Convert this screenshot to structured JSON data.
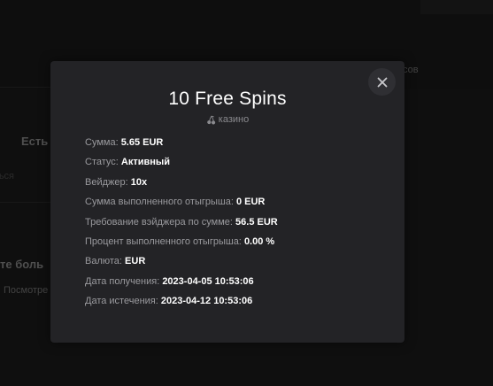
{
  "background": {
    "fragments": [
      "сов",
      "Есть",
      "Зарегистрироваться",
      "те боль",
      "Посмотре"
    ]
  },
  "modal": {
    "title": "10 Free Spins",
    "category_icon": "cherry-icon",
    "category": "казино",
    "close_icon": "close-icon",
    "details": [
      {
        "label": "Сумма:",
        "value": "5.65 EUR"
      },
      {
        "label": "Статус:",
        "value": "Активный"
      },
      {
        "label": "Вейджер:",
        "value": "10x"
      },
      {
        "label": "Сумма выполненного отыгрыша:",
        "value": "0 EUR"
      },
      {
        "label": "Требование вэйджера по сумме:",
        "value": "56.5 EUR"
      },
      {
        "label": "Процент выполненного отыгрыша:",
        "value": "0.00 %"
      },
      {
        "label": "Валюта:",
        "value": "EUR"
      },
      {
        "label": "Дата получения:",
        "value": "2023-04-05 10:53:06"
      },
      {
        "label": "Дата истечения:",
        "value": "2023-04-12 10:53:06"
      }
    ]
  },
  "colors": {
    "modal_bg": "#232326",
    "page_bg": "#141414",
    "label": "#9a9a9e",
    "value": "#ffffff"
  }
}
